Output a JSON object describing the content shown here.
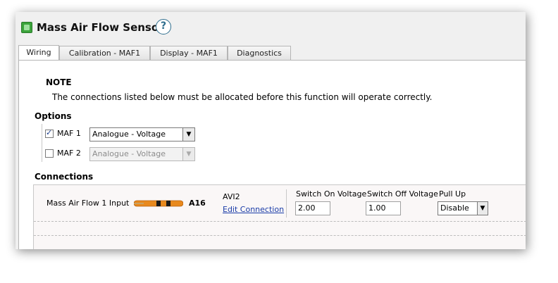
{
  "header": {
    "title": "Mass Air Flow Sensor",
    "help_glyph": "?"
  },
  "tabs": [
    {
      "label": "Wiring",
      "active": true
    },
    {
      "label": "Calibration - MAF1",
      "active": false
    },
    {
      "label": "Display - MAF1",
      "active": false
    },
    {
      "label": "Diagnostics",
      "active": false
    }
  ],
  "note": {
    "heading": "NOTE",
    "text": "The connections listed below must be allocated before this function will operate correctly."
  },
  "options": {
    "heading": "Options",
    "items": [
      {
        "label": "MAF 1",
        "checked": true,
        "value": "Analogue - Voltage",
        "enabled": true
      },
      {
        "label": "MAF 2",
        "checked": false,
        "value": "Analogue - Voltage",
        "enabled": false
      }
    ]
  },
  "connections": {
    "heading": "Connections",
    "row": {
      "name": "Mass Air Flow 1 Input",
      "pin": "A16",
      "channel": "AVI2",
      "edit_link": "Edit Connection",
      "switch_on_label": "Switch On Voltage",
      "switch_on_value": "2.00",
      "switch_off_label": "Switch Off Voltage",
      "switch_off_value": "1.00",
      "pullup_label": "Pull Up",
      "pullup_value": "Disable"
    }
  },
  "colors": {
    "wire_orange": "#e8891e",
    "wire_band": "#1a1a1a",
    "accent_green": "#3ba33b"
  }
}
